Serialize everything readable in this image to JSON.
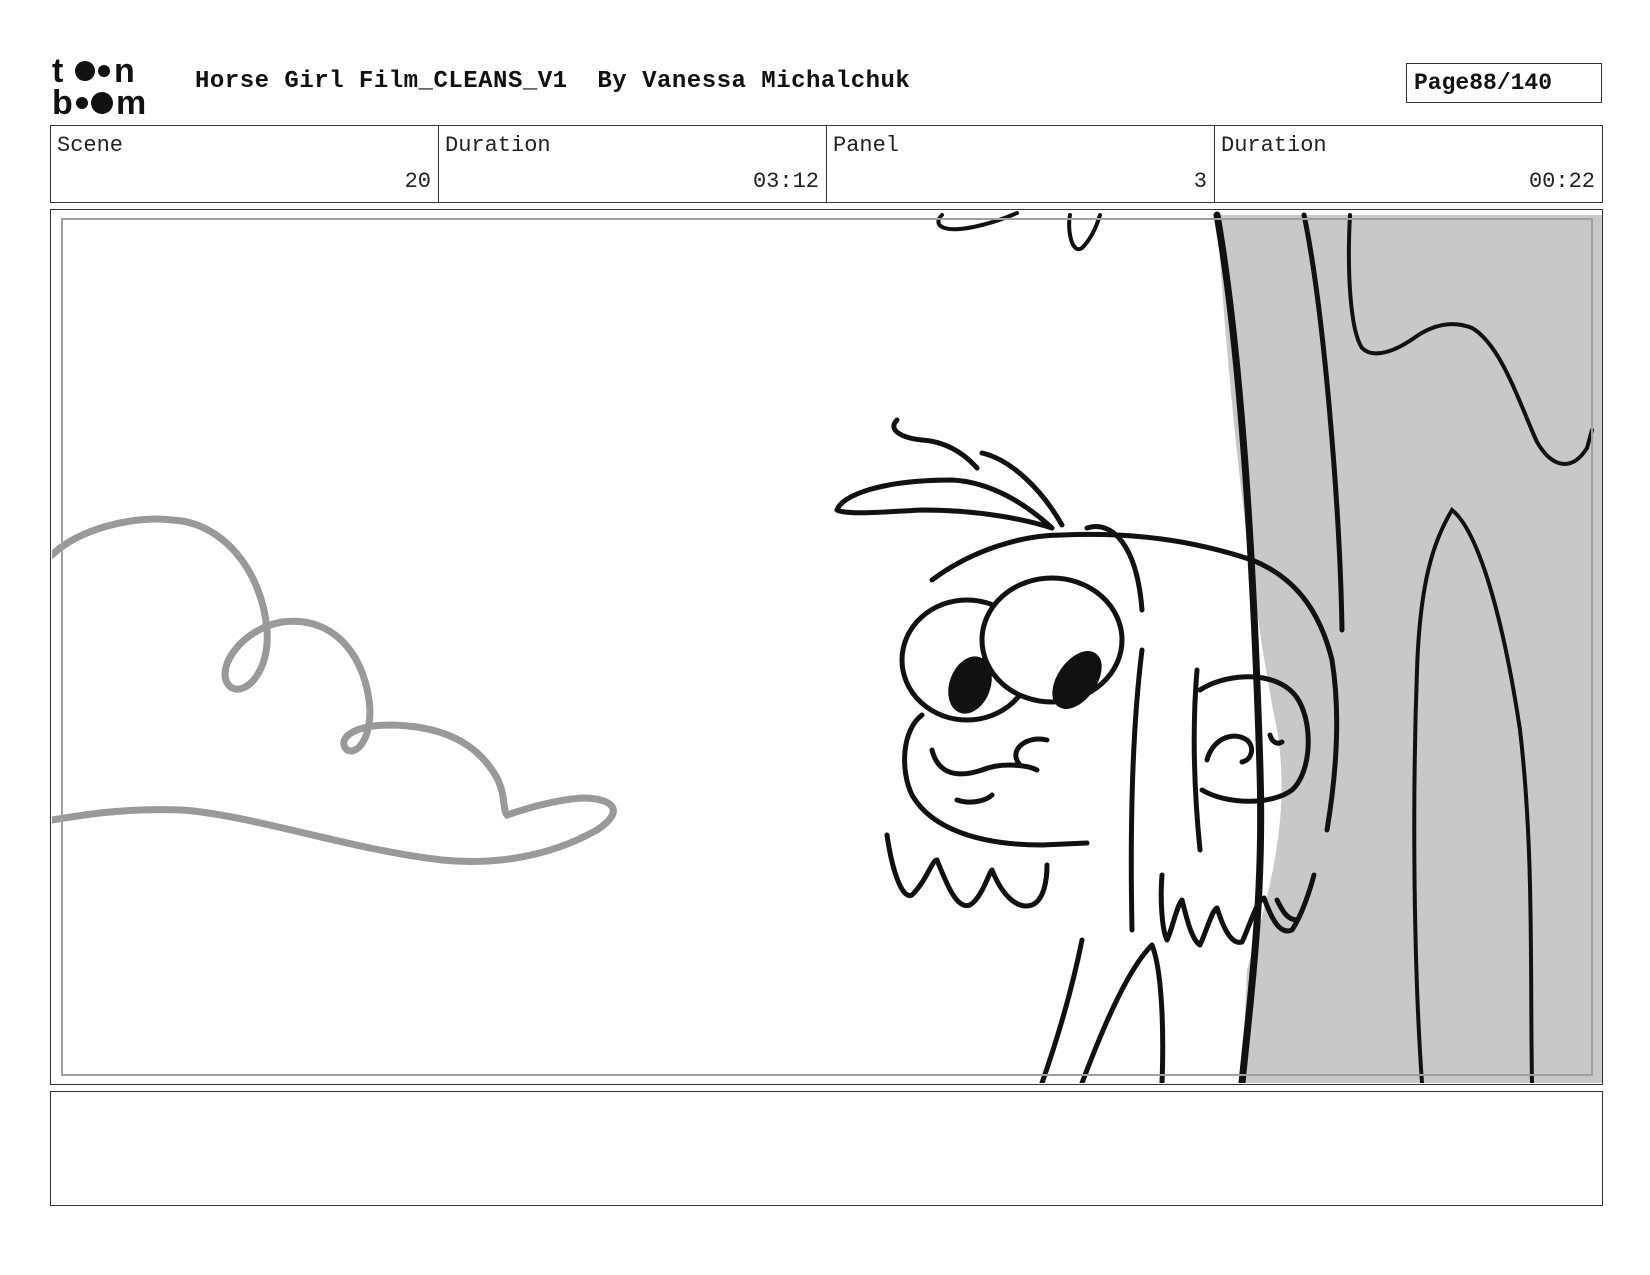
{
  "header": {
    "logo_text": "toon boom",
    "project_title": "Horse Girl Film_CLEANS_V1",
    "author": "By Vanessa Michalchuk",
    "page_label": "Page",
    "page_number": "88/140"
  },
  "info": {
    "scene_label": "Scene",
    "scene_value": "20",
    "scene_duration_label": "Duration",
    "scene_duration_value": "03:12",
    "panel_label": "Panel",
    "panel_value": "3",
    "panel_duration_label": "Duration",
    "panel_duration_value": "00:22"
  },
  "notes": {
    "text": ""
  },
  "colors": {
    "tree_fill": "#c8c8c8",
    "ink": "#111111",
    "cloud_gray": "#999999"
  }
}
